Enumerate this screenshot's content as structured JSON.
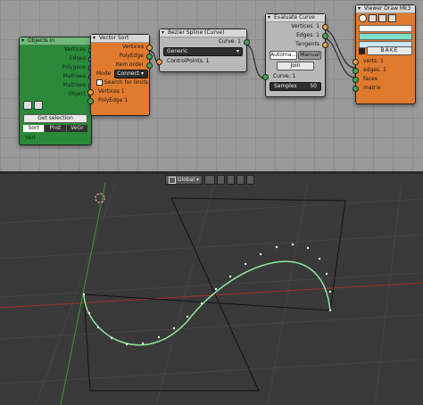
{
  "objects_in": {
    "title": "Objects in",
    "outputs": [
      "Vertices",
      "Edges",
      "Polygons",
      "Matrixes",
      "Matrixes",
      "Object"
    ],
    "get_selection": "Get selection",
    "sort_tabs": [
      "Sort",
      "Pnst",
      "VeGr"
    ],
    "footer": "Vert"
  },
  "vector_sort": {
    "title": "Vector Sort",
    "outputs": [
      "Vertices",
      "PolyEdge",
      "Item order"
    ],
    "mode_label": "Mode",
    "mode_value": "Connect",
    "search_limits": "Search for limits",
    "inputs": [
      "Vertices 1",
      "PolyEdge 1"
    ]
  },
  "bezier": {
    "title": "Bezier Spline (Curve)",
    "curve_out": "Curve. 1",
    "mode": "Generic",
    "control_points": "ControlPoints. 1"
  },
  "evaluate": {
    "title": "Evaluate Curve",
    "outputs": [
      "Vertices. 1",
      "Edges. 1",
      "Tangents"
    ],
    "auto_btn": "Automa...",
    "manual_btn": "Manual",
    "join_btn": "Join",
    "curve_in": "Curve. 1",
    "samples_label": "Samples",
    "samples_value": "50"
  },
  "viewer": {
    "title": "Viewer Draw Mk3",
    "bake": "BAKE",
    "inputs": [
      "verts. 1",
      "edges. 1",
      "faces",
      "matrix"
    ]
  },
  "viewport_header": {
    "orientation": "Global"
  },
  "colors": {
    "green_node": "#2a8a3a",
    "orange_node": "#e07a2e",
    "gray_node": "#b8b8b8",
    "accent_curve": "#8ce89a"
  }
}
